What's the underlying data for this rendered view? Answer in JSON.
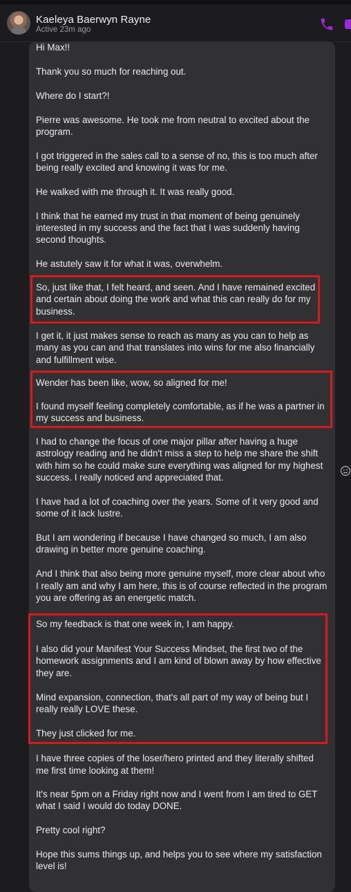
{
  "header": {
    "contact_name": "Kaeleya Baerwyn Rayne",
    "status": "Active 23m ago",
    "icons": [
      "avatar",
      "phone-icon",
      "video-icon"
    ],
    "accent": "#9b2bd6"
  },
  "message": {
    "lines": [
      "Hi Max!!",
      "Thank you so much for reaching out.",
      "Where do I start?!",
      "Pierre was awesome.  He took me from neutral to excited about the",
      "program.",
      "I got triggered in the sales call to a sense of no, this is too much after",
      "being really excited and knowing it was for me.",
      "He walked with me through it. It was really good.",
      "I think that he earned my trust in that moment of being genuinely",
      "interested in my success and the fact that I was suddenly having",
      "second thoughts.",
      "He astutely saw it for what it was, overwhelm.",
      "So, just like that, I felt heard, and seen.  And I have remained excited",
      "and certain about doing the work and what this can really do for my",
      "business.",
      "I get it, it just makes sense to reach as many as you can to help as",
      "many as you can and that translates into wins for me also financially",
      "and fulfillment wise.",
      "Wender has been like, wow, so aligned for me!",
      "I found myself feeling completely comfortable, as if he was a partner in",
      "my success and business.",
      "I had to change the focus of one major pillar after having a huge",
      "astrology reading and he didn't miss a step to help me share the shift",
      "with him so he could make sure everything was aligned for my highest",
      "success.  I really noticed and appreciated that.",
      "I have had a lot of coaching over the years. Some of it very good and",
      "some of it lack lustre.",
      "But I am wondering if because I have changed so much, I am also",
      "drawing in better more genuine coaching.",
      "And I think that also being more genuine myself, more clear about who",
      "I really am and why I am here, this is of course reflected in the program",
      "you are offering as an energetic match.",
      "So my feedback is that one week in, I am happy.",
      "I also did your Manifest Your Success Mindset, the first two of the",
      "homework assignments and I am kind of blown away by how effective",
      "they are.",
      "Mind expansion, connection, that's all part of my way of being but I",
      "really really LOVE these.",
      "They just clicked for me.",
      "I have three copies of the loser/hero printed and they literally shifted",
      "me first time looking at them!",
      "It's near 5pm on a Friday right now and I went from I am tired to GET",
      "what I said I would do today DONE.",
      "Pretty cool right?",
      "Hope this sums things up, and helps you to see where my satisfaction",
      "level is!"
    ]
  },
  "highlight_color": "#d81a1f"
}
